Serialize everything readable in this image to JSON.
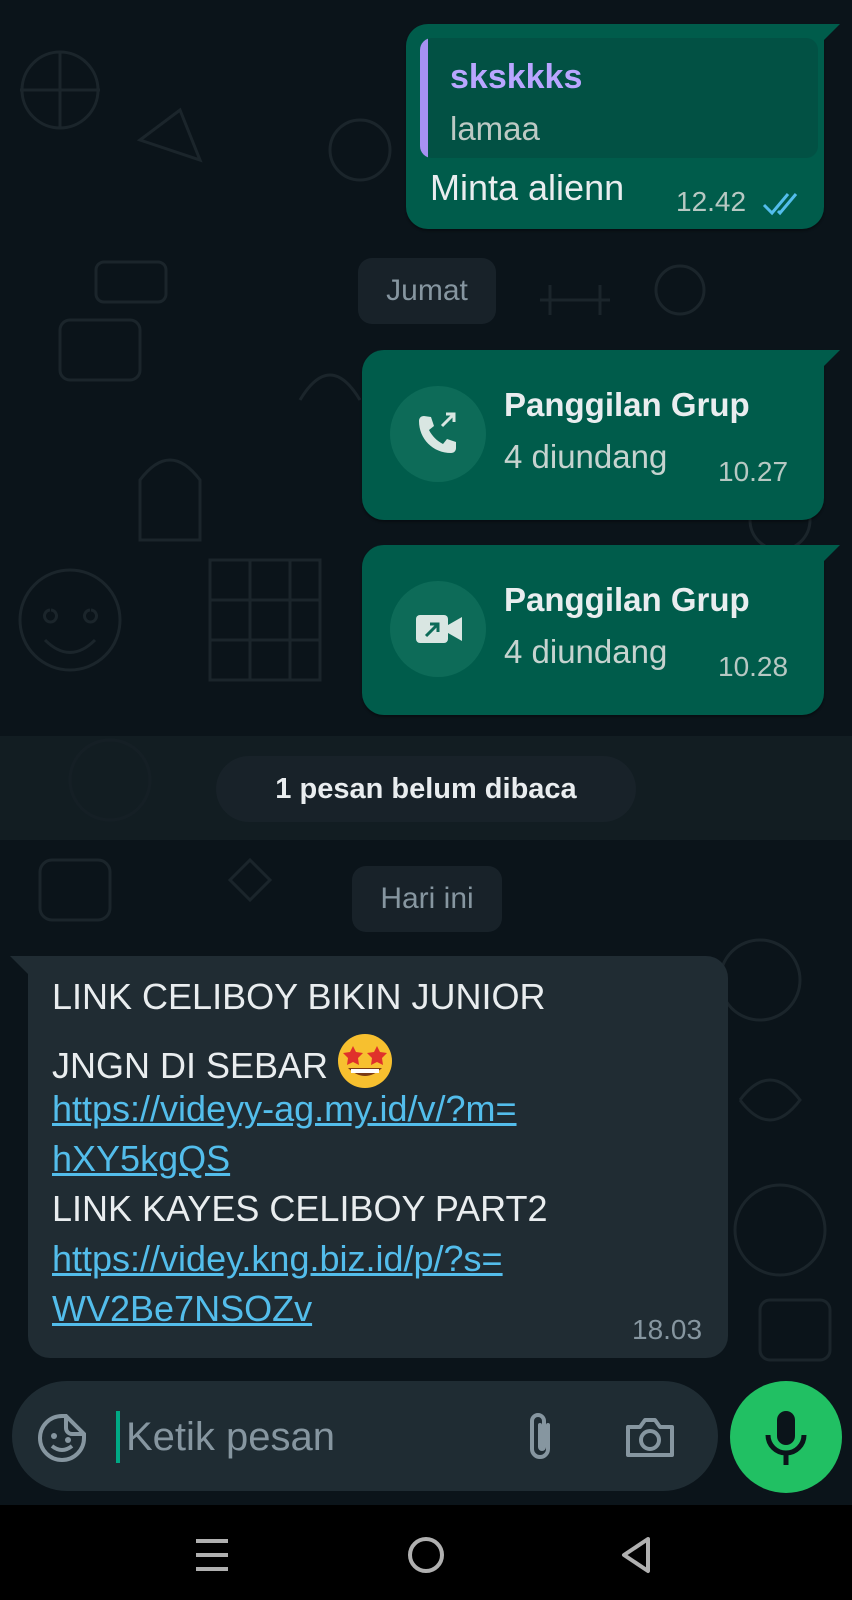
{
  "colors": {
    "background": "#0b141a",
    "outgoing_bubble": "#005c4b",
    "incoming_bubble": "#202c33",
    "link": "#53bdeb",
    "accent_green": "#21c063",
    "read_ticks": "#53bdeb"
  },
  "messages": {
    "reply": {
      "quote_name": "skskkks",
      "quote_text": "lamaa",
      "text": "Minta alienn",
      "time": "12.42",
      "status_icon": "double-check-read-icon"
    },
    "date_friday": "Jumat",
    "call_voice": {
      "title": "Panggilan Grup",
      "subtitle": "4 diundang",
      "time": "10.27",
      "icon": "call-icon"
    },
    "call_video": {
      "title": "Panggilan Grup",
      "subtitle": "4 diundang",
      "time": "10.28",
      "icon": "video-call-icon"
    },
    "unread_banner": "1 pesan belum dibaca",
    "date_today": "Hari ini",
    "incoming": {
      "line1": "LINK CELIBOY BIKIN JUNIOR",
      "line2": "JNGN DI SEBAR",
      "emoji": "star-struck-emoji-icon",
      "link1_line1": "https://videyy-ag.my.id/v/?m=",
      "link1_line2": "hXY5kgQS",
      "line3": "LINK KAYES CELIBOY PART2",
      "link2_line1": "https://videy.kng.biz.id/p/?s=",
      "link2_line2": "WV2Be7NSOZv",
      "time": "18.03"
    }
  },
  "composer": {
    "placeholder": "Ketik pesan",
    "value": "",
    "icons": [
      "sticker-icon",
      "attach-icon",
      "camera-icon",
      "mic-icon"
    ]
  },
  "navbar": {
    "icons": [
      "recents-icon",
      "home-icon",
      "back-icon"
    ]
  }
}
